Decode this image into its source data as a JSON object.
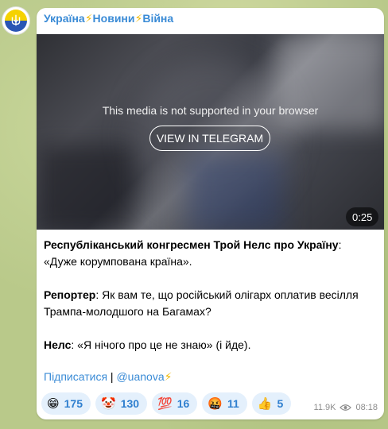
{
  "channel": {
    "name_part1": "Україна",
    "name_part2": "Новини",
    "name_part3": "Війна",
    "bolt": "⚡"
  },
  "media": {
    "unsupported_message": "This media is not supported in your browser",
    "view_button_label": "VIEW IN TELEGRAM",
    "duration": "0:25"
  },
  "post": {
    "p1_bold": "Республіканський конгресмен Трой Нелс про Україну",
    "p1_rest": ": «Дуже корумпована країна».",
    "p2_bold": "Репортер",
    "p2_rest": ": Як вам те, що російський олігарх оплатив весілля Трампа-молодшого на Багамах?",
    "p3_bold": "Нелс",
    "p3_rest": ": «Я нічого про це не знаю» (і йде).",
    "subscribe_label": "Підписатися",
    "separator": " | ",
    "handle": "@uanova",
    "bolt": "⚡"
  },
  "reactions": [
    {
      "emoji": "😁",
      "count": "175"
    },
    {
      "emoji": "🤡",
      "count": "130"
    },
    {
      "emoji": "💯",
      "count": "16"
    },
    {
      "emoji": "🤬",
      "count": "11"
    },
    {
      "emoji": "👍",
      "count": "5"
    }
  ],
  "meta": {
    "views": "11.9K",
    "time": "08:18"
  },
  "colors": {
    "accent": "#3a8bd6",
    "reaction_bg": "#e4f0fc",
    "bolt": "#f1b900"
  }
}
